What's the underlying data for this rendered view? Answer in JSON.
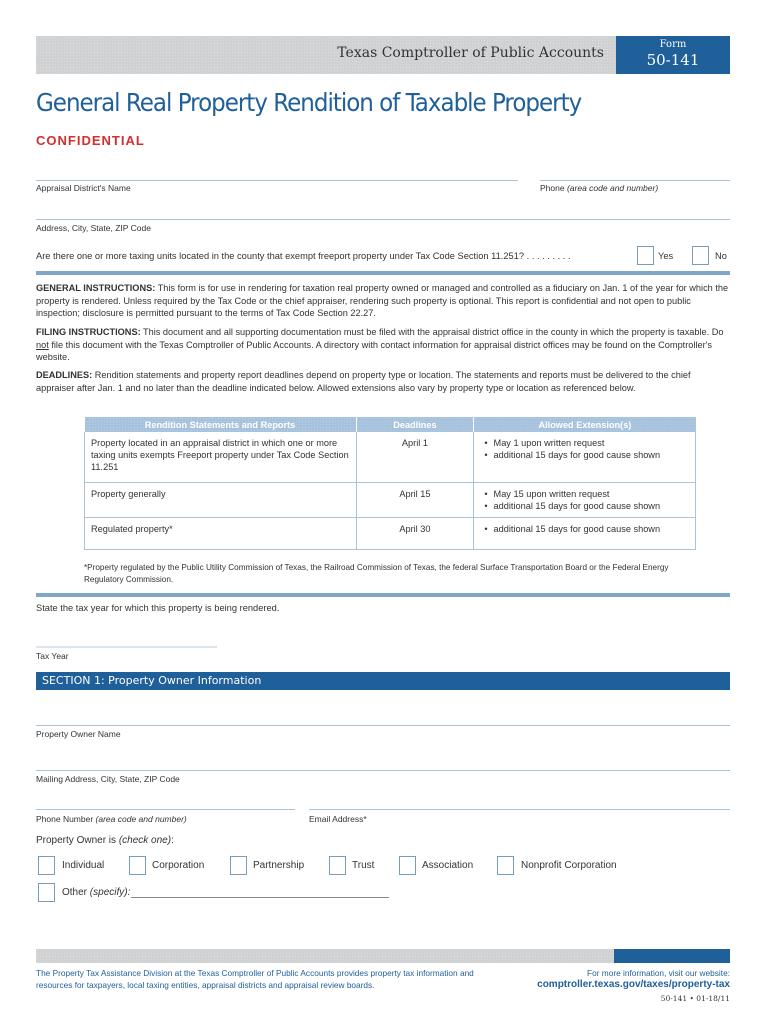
{
  "header": {
    "agency": "Texas Comptroller of Public Accounts",
    "form_label": "Form",
    "form_number": "50-141"
  },
  "title": "General Real Property Rendition of Taxable Property",
  "confidential": "CONFIDENTIAL",
  "fields_top": {
    "appraisal_district_name": "Appraisal District's Name",
    "phone_label": "Phone",
    "phone_hint": "(area code and number)",
    "address": "Address, City, State, ZIP Code"
  },
  "freeport_question": {
    "text": "Are there one or more taxing units located in the county that exempt freeport property under Tax Code Section 11.251? . . . . . . . . .",
    "yes": "Yes",
    "no": "No"
  },
  "instructions": {
    "general_heading": "GENERAL INSTRUCTIONS:",
    "general_text": " This form is for use in rendering for taxation real property owned or managed and controlled as a fiduciary on Jan. 1 of the year for which the property is rendered. Unless required by the Tax Code or the chief appraiser, rendering such property is optional. This report is confidential and not open to public inspection; disclosure is permitted pursuant to the terms of Tax Code Section 22.27.",
    "filing_heading": "FILING INSTRUCTIONS:",
    "filing_text_1": " This document and all supporting documentation must be filed with the appraisal district office in the county in which the property is taxable. Do ",
    "filing_not": "not",
    "filing_text_2": " file this document with the Texas Comptroller of Public Accounts. A directory with contact information for appraisal district offices may be found on the Comptroller's website.",
    "deadlines_heading": "DEADLINES:",
    "deadlines_text": " Rendition statements and property report deadlines depend on property type or location. The statements and reports must be delivered to the chief appraiser after Jan. 1 and no later than the deadline indicated below. Allowed extensions also vary by property type or location as referenced below."
  },
  "deadline_table": {
    "headers": [
      "Rendition Statements and Reports",
      "Deadlines",
      "Allowed Extension(s)"
    ],
    "rows": [
      {
        "statement": "Property located in an appraisal district in which one or more taxing units exempts Freeport property under Tax Code Section 11.251",
        "deadline": "April 1",
        "extensions": [
          "May 1 upon written request",
          "additional 15 days for good cause shown"
        ]
      },
      {
        "statement": "Property generally",
        "deadline": "April 15",
        "extensions": [
          "May 15 upon written request",
          "additional 15 days for good cause shown"
        ]
      },
      {
        "statement": "Regulated property*",
        "deadline": "April 30",
        "extensions": [
          "additional 15 days for good cause shown"
        ]
      }
    ]
  },
  "footnote": "*Property regulated by the Public Utility Commission of Texas, the Railroad Commission of Texas, the federal Surface Transportation Board or the Federal Energy Regulatory Commission.",
  "tax_year": {
    "prompt": "State the tax year for which this property is being rendered.",
    "label": "Tax Year"
  },
  "section1": {
    "title": "SECTION 1: Property Owner Information",
    "owner_name": "Property Owner Name",
    "mailing_address": "Mailing Address, City, State, ZIP Code",
    "phone_label": "Phone Number",
    "phone_hint": "(area code and number)",
    "email": "Email Address*",
    "owner_is": "Property Owner is",
    "owner_is_hint": "(check one)",
    "owner_is_colon": ":",
    "owner_types": [
      "Individual",
      "Corporation",
      "Partnership",
      "Trust",
      "Association",
      "Nonprofit Corporation"
    ],
    "other_label": "Other",
    "other_hint": "(specify):"
  },
  "footer": {
    "text": "The Property Tax Assistance Division at the Texas Comptroller of Public Accounts provides property tax information and resources for taxpayers, local taxing entities, appraisal districts and appraisal review boards.",
    "more_info": "For more information, visit our website:",
    "url": "comptroller.texas.gov/taxes/property-tax",
    "form_code": "50-141 • 01-18/11"
  },
  "colors": {
    "brand_blue": "#1f5f9a",
    "rule_blue": "#7ea7c9",
    "confidential_red": "#d32f2f"
  }
}
